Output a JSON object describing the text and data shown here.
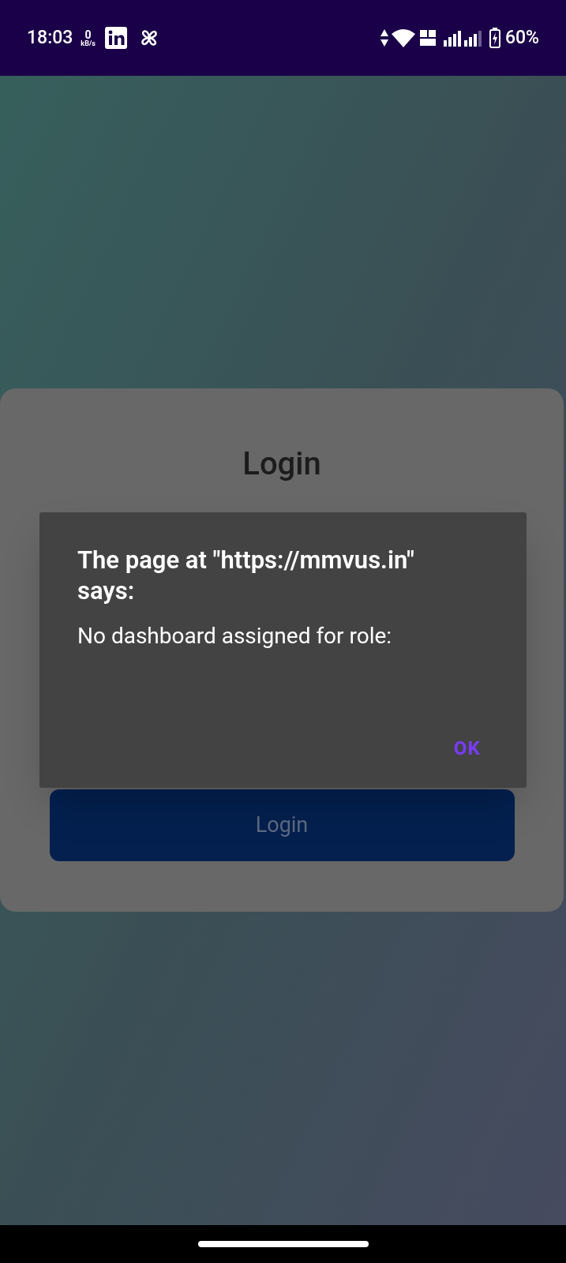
{
  "status_bar": {
    "time": "18:03",
    "speed_value": "0",
    "speed_unit": "kB/s",
    "battery": "60%"
  },
  "login_card": {
    "title": "Login",
    "button": "Login"
  },
  "alert": {
    "title": "The page at \"https://mmvus.in\" says:",
    "message": "No dashboard assigned for role:",
    "button": "OK"
  }
}
